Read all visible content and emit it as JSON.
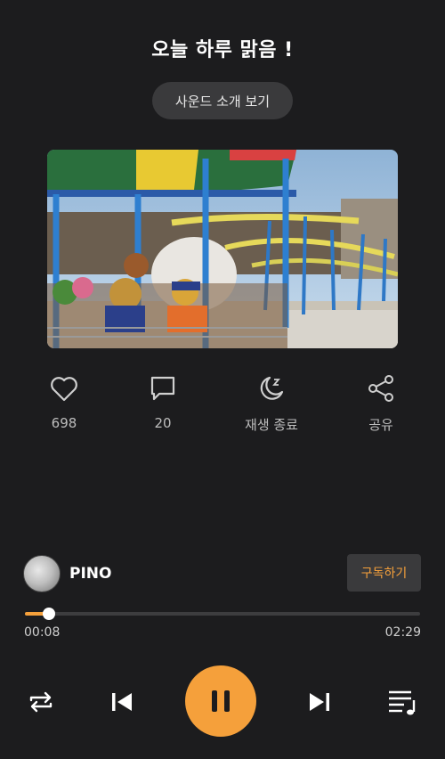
{
  "header": {
    "title": "오늘 하루 맑음 !",
    "intro_button": "사운드 소개 보기"
  },
  "cover": {
    "description_icon": "amusement-park-photo"
  },
  "actions": [
    {
      "icon": "heart-icon",
      "label": "698"
    },
    {
      "icon": "comment-icon",
      "label": "20"
    },
    {
      "icon": "sleep-timer-icon",
      "label": "재생 종료"
    },
    {
      "icon": "share-icon",
      "label": "공유"
    }
  ],
  "artist": {
    "name": "PINO",
    "subscribe_label": "구독하기"
  },
  "player": {
    "current_time": "00:08",
    "total_time": "02:29",
    "progress": 0.06
  },
  "controls": {
    "repeat": "repeat-icon",
    "previous": "skip-previous-icon",
    "play_pause": "pause-icon",
    "next": "skip-next-icon",
    "playlist": "playlist-icon"
  },
  "colors": {
    "accent": "#f5a03b",
    "background": "#1c1c1e",
    "surface": "#3a3a3c"
  }
}
